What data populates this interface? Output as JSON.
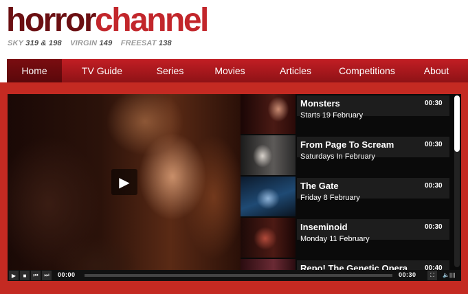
{
  "header": {
    "logo_word1": "horror",
    "logo_word2": "channel",
    "carriers": [
      {
        "label": "SKY",
        "number": "319 & 198"
      },
      {
        "label": "VIRGIN",
        "number": "149"
      },
      {
        "label": "FREESAT",
        "number": "138"
      }
    ]
  },
  "nav": {
    "items": [
      "Home",
      "TV Guide",
      "Series",
      "Movies",
      "Articles",
      "Competitions",
      "About"
    ],
    "active": "Home"
  },
  "player": {
    "current_time": "00:00",
    "total_time": "00:30",
    "play_icon": "play-icon"
  },
  "playlist": [
    {
      "title": "Monsters",
      "subtitle": "Starts 19 February",
      "duration": "00:30"
    },
    {
      "title": "From Page To Scream",
      "subtitle": "Saturdays In February",
      "duration": "00:30"
    },
    {
      "title": "The Gate",
      "subtitle": "Friday 8 February",
      "duration": "00:30"
    },
    {
      "title": "Inseminoid",
      "subtitle": "Monday 11 February",
      "duration": "00:30"
    },
    {
      "title": "Repo! The Genetic Opera",
      "subtitle": "",
      "duration": "00:40"
    }
  ],
  "colors": {
    "brand_dark": "#6b0f12",
    "brand_red": "#c2262b",
    "frame": "#c42a22"
  }
}
